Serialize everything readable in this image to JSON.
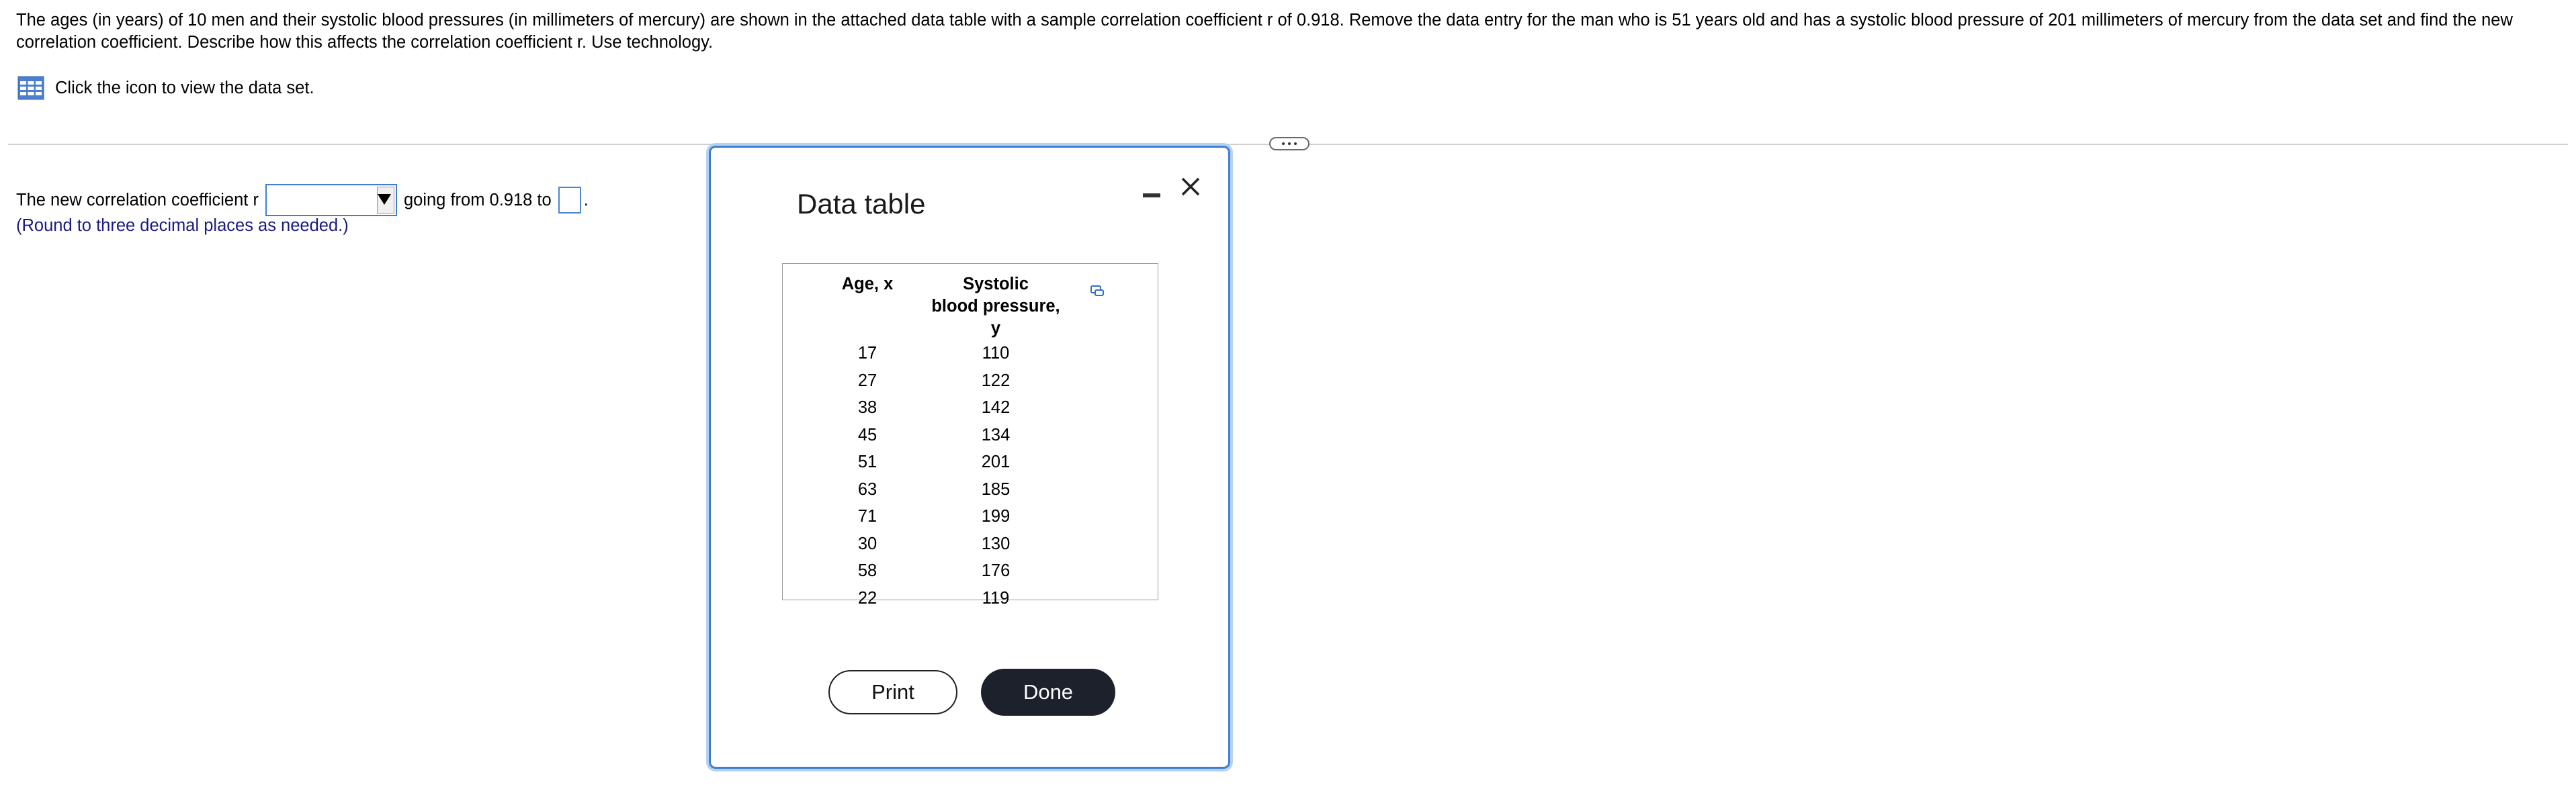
{
  "question": {
    "text": "The ages (in years) of 10 men and their systolic blood pressures (in millimeters of mercury) are shown in the attached data table with a sample correlation coefficient r of 0.918. Remove the data entry for the man who is 51 years old and has a systolic blood pressure of 201 millimeters of mercury from the data set and find the new correlation coefficient. Describe how this affects the correlation coefficient r. Use technology."
  },
  "dataset_link": {
    "icon": "table-grid-icon",
    "label": "Click the icon to view the data set."
  },
  "more_button": {
    "icon": "ellipsis-icon"
  },
  "answer": {
    "prefix": "The new correlation coefficient r",
    "dropdown_value": "",
    "middle": "going from 0.918 to",
    "input_value": "",
    "suffix": ".",
    "note": "(Round to three decimal places as needed.)"
  },
  "modal": {
    "title": "Data table",
    "minimize_icon": "minimize-icon",
    "close_icon": "close-icon",
    "copy_icon": "copy-icon",
    "table": {
      "headers": {
        "age": "Age, x",
        "bp_line1": "Systolic",
        "bp_line2": "blood pressure, y"
      },
      "rows": [
        {
          "age": "17",
          "bp": "110"
        },
        {
          "age": "27",
          "bp": "122"
        },
        {
          "age": "38",
          "bp": "142"
        },
        {
          "age": "45",
          "bp": "134"
        },
        {
          "age": "51",
          "bp": "201"
        },
        {
          "age": "63",
          "bp": "185"
        },
        {
          "age": "71",
          "bp": "199"
        },
        {
          "age": "30",
          "bp": "130"
        },
        {
          "age": "58",
          "bp": "176"
        },
        {
          "age": "22",
          "bp": "119"
        }
      ]
    },
    "print_label": "Print",
    "done_label": "Done"
  },
  "colors": {
    "accent_blue": "#3d7fd2",
    "note_blue": "#1a1a80",
    "done_bg": "#1c212b",
    "divider": "#cfcfcf"
  }
}
